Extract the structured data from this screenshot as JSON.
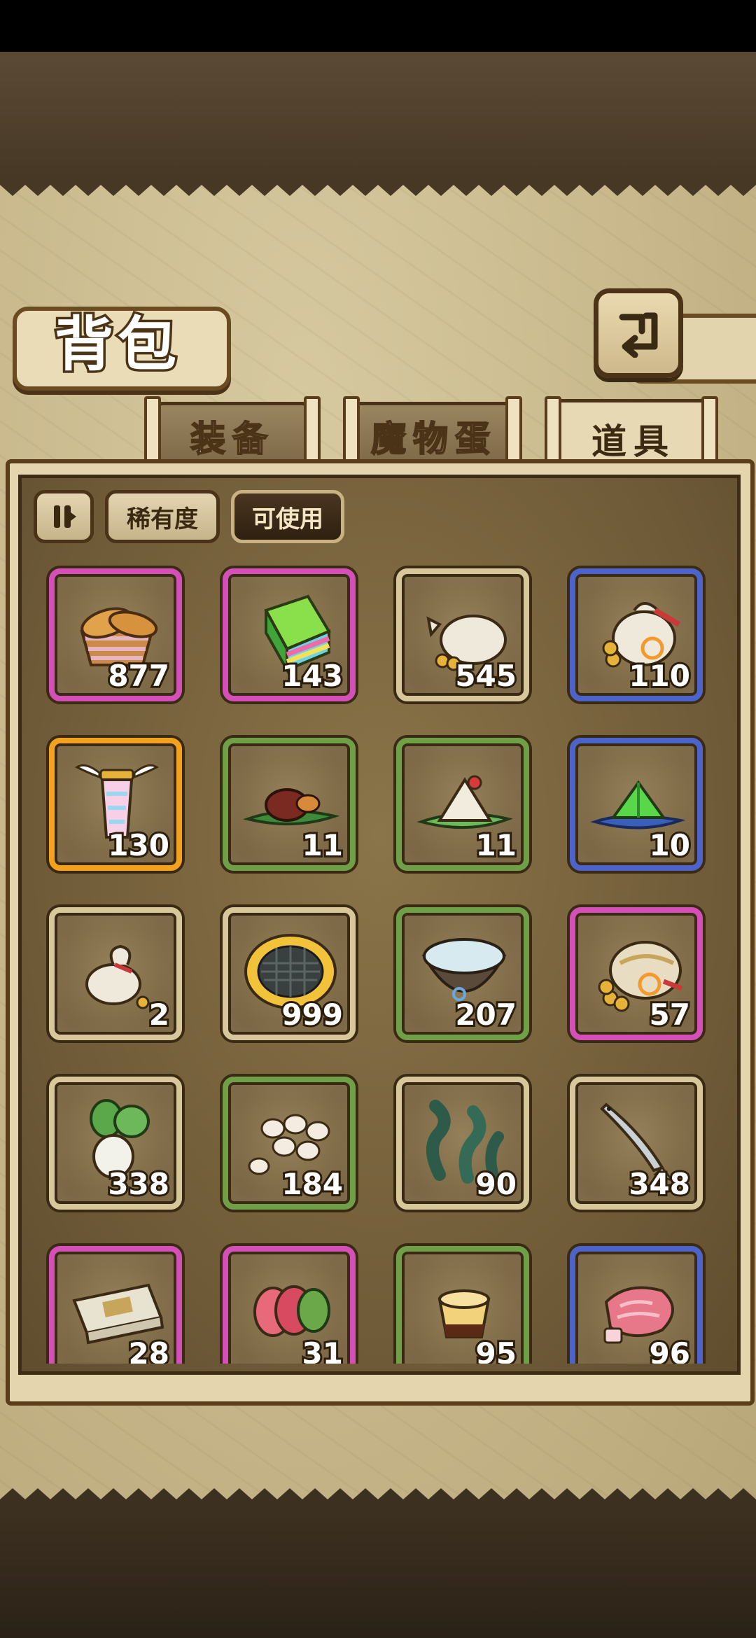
{
  "colors": {
    "rarity_common": "#d9c79c",
    "rarity_uncommon": "#6fa048",
    "rarity_rare": "#4c63c9",
    "rarity_epic": "#d44fb8",
    "rarity_legendary": "#f2a21e"
  },
  "header": {
    "title": "背包",
    "back_icon": "return-arrow-icon"
  },
  "tabs": [
    {
      "label": "装备",
      "active": false
    },
    {
      "label": "魔物蛋",
      "active": false
    },
    {
      "label": "道具",
      "active": true
    }
  ],
  "filters": {
    "sort_icon": "sort-order-icon",
    "rarity_label": "稀有度",
    "usable_label": "可使用",
    "usable_active": true
  },
  "items": [
    {
      "icon": "bread-basket-icon",
      "qty": "877",
      "rarity": "epic"
    },
    {
      "icon": "color-blocks-icon",
      "qty": "143",
      "rarity": "epic"
    },
    {
      "icon": "coin-sack-icon",
      "qty": "545",
      "rarity": "common"
    },
    {
      "icon": "treasure-sack-icon",
      "qty": "110",
      "rarity": "rare"
    },
    {
      "icon": "winged-lantern-icon",
      "qty": "130",
      "rarity": "legendary"
    },
    {
      "icon": "meat-leaf-icon",
      "qty": "11",
      "rarity": "uncommon"
    },
    {
      "icon": "rice-dumpling-icon",
      "qty": "11",
      "rarity": "uncommon"
    },
    {
      "icon": "green-crystal-icon",
      "qty": "10",
      "rarity": "rare"
    },
    {
      "icon": "small-sack-icon",
      "qty": "2",
      "rarity": "common"
    },
    {
      "icon": "waffle-cookie-icon",
      "qty": "999",
      "rarity": "common"
    },
    {
      "icon": "water-bowl-icon",
      "qty": "207",
      "rarity": "uncommon"
    },
    {
      "icon": "gold-sack-icon",
      "qty": "57",
      "rarity": "epic"
    },
    {
      "icon": "radish-icon",
      "qty": "338",
      "rarity": "common"
    },
    {
      "icon": "eggs-icon",
      "qty": "184",
      "rarity": "uncommon"
    },
    {
      "icon": "seaweed-icon",
      "qty": "90",
      "rarity": "common"
    },
    {
      "icon": "fish-icon",
      "qty": "348",
      "rarity": "common"
    },
    {
      "icon": "banknotes-icon",
      "qty": "28",
      "rarity": "epic"
    },
    {
      "icon": "ham-slices-icon",
      "qty": "31",
      "rarity": "epic"
    },
    {
      "icon": "pudding-icon",
      "qty": "95",
      "rarity": "uncommon"
    },
    {
      "icon": "raw-meat-icon",
      "qty": "96",
      "rarity": "rare"
    }
  ]
}
